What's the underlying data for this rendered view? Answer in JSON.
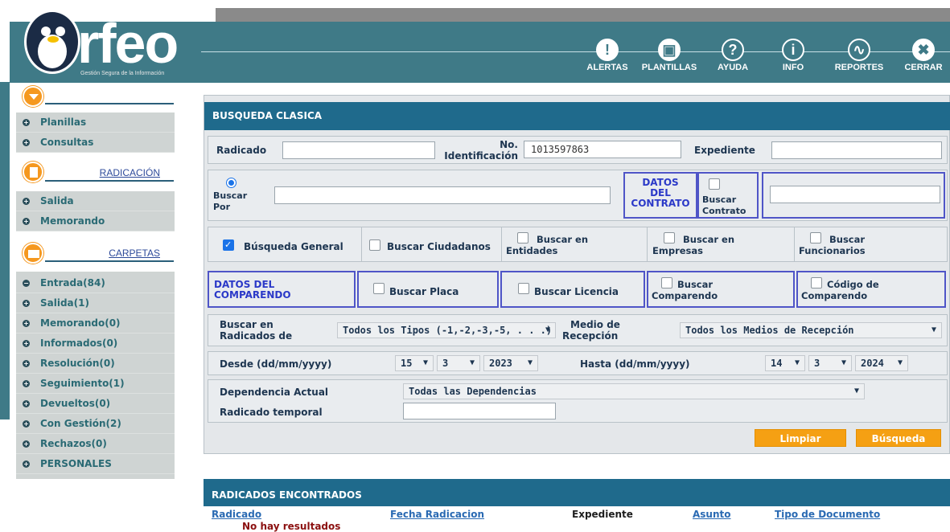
{
  "brand": {
    "logo_text": "rfeo",
    "tagline": "Gestión Segura de la Información"
  },
  "nav": [
    {
      "label": "ALERTAS",
      "icon": "alert-icon",
      "glyph": "!"
    },
    {
      "label": "PLANTILLAS",
      "icon": "templates-icon",
      "glyph": "▣"
    },
    {
      "label": "AYUDA",
      "icon": "help-icon",
      "glyph": "?"
    },
    {
      "label": "INFO",
      "icon": "info-icon",
      "glyph": "i"
    },
    {
      "label": "REPORTES",
      "icon": "reports-icon",
      "glyph": "∿"
    },
    {
      "label": "CERRAR",
      "icon": "close-icon",
      "glyph": "✖"
    }
  ],
  "sidebar": {
    "group1": [
      "Planillas",
      "Consultas"
    ],
    "radicacion_title": "RADICACIÓN",
    "group2": [
      "Salida",
      "Memorando"
    ],
    "carpetas_title": "CARPETAS",
    "group3": [
      {
        "label": "Entrada(84)",
        "bullet": "−"
      },
      {
        "label": "Salida(1)",
        "bullet": "+"
      },
      {
        "label": "Memorando(0)",
        "bullet": "+"
      },
      {
        "label": "Informados(0)",
        "bullet": "+"
      },
      {
        "label": "Resolución(0)",
        "bullet": "+"
      },
      {
        "label": "Seguimiento(1)",
        "bullet": "+"
      },
      {
        "label": "Devueltos(0)",
        "bullet": "+"
      },
      {
        "label": "Con Gestión(2)",
        "bullet": "+"
      },
      {
        "label": "Rechazos(0)",
        "bullet": "+"
      },
      {
        "label": "PERSONALES",
        "bullet": "+"
      }
    ]
  },
  "search": {
    "title": "BUSQUEDA CLASICA",
    "radicado_label": "Radicado",
    "radicado_value": "",
    "identificacion_label_1": "No.",
    "identificacion_label_2": "Identificación",
    "identificacion_value": "1013597863",
    "expediente_label": "Expediente",
    "expediente_value": "",
    "buscar_por_1": "Buscar",
    "buscar_por_2": "Por",
    "buscar_por_value": "",
    "datos_contrato_1": "DATOS",
    "datos_contrato_2": "DEL",
    "datos_contrato_3": "CONTRATO",
    "buscar_contrato_1": "Buscar",
    "buscar_contrato_2": "Contrato",
    "contrato_value": "",
    "busqueda_general": "Búsqueda General",
    "buscar_ciudadanos": "Buscar Ciudadanos",
    "buscar_entidades_1": "Buscar en",
    "buscar_entidades_2": "Entidades",
    "buscar_empresas_1": "Buscar en",
    "buscar_empresas_2": "Empresas",
    "buscar_funcionarios_1": "Buscar",
    "buscar_funcionarios_2": "Funcionarios",
    "datos_comparendo_1": "DATOS DEL",
    "datos_comparendo_2": "COMPARENDO",
    "buscar_placa": "Buscar Placa",
    "buscar_licencia": "Buscar Licencia",
    "buscar_comparendo_1": "Buscar",
    "buscar_comparendo_2": "Comparendo",
    "codigo_comparendo_1": "Código de",
    "codigo_comparendo_2": "Comparendo",
    "buscar_en_1": "Buscar en",
    "buscar_en_2": "Radicados de",
    "tipos_value": "Todos los Tipos (-1,-2,-3,-5, . . .)",
    "medio_1": "Medio de",
    "medio_2": "Recepción",
    "medio_value": "Todos los Medios de Recepción",
    "desde_label": "Desde (dd/mm/yyyy)",
    "desde_day": "15",
    "desde_month": "3",
    "desde_year": "2023",
    "hasta_label": "Hasta (dd/mm/yyyy)",
    "hasta_day": "14",
    "hasta_month": "3",
    "hasta_year": "2024",
    "dependencia_label": "Dependencia Actual",
    "dependencia_value": "Todas las Dependencias",
    "temporal_label": "Radicado temporal",
    "temporal_value": "",
    "limpiar": "Limpiar",
    "busqueda": "Búsqueda"
  },
  "results": {
    "title": "RADICADOS ENCONTRADOS",
    "cols": [
      "Radicado",
      "Fecha Radicacion",
      "Expediente",
      "Asunto",
      "Tipo de Documento"
    ],
    "empty": "No hay resultados"
  },
  "colors": {
    "teal": "#3f7a87",
    "blue_header": "#1f6a8c",
    "orange": "#f5a013"
  }
}
